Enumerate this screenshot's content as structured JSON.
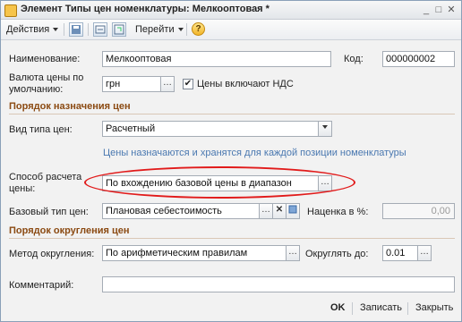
{
  "window": {
    "title": "Элемент Типы цен номенклатуры: Мелкооптовая *",
    "minimize": "_",
    "maximize": "□",
    "close": "✕"
  },
  "toolbar": {
    "actions_label": "Действия",
    "goto_label": "Перейти",
    "help_glyph": "?"
  },
  "form": {
    "name_label": "Наименование:",
    "name_value": "Мелкооптовая",
    "code_label": "Код:",
    "code_value": "000000002",
    "currency_label": "Валюта цены по умолчанию:",
    "currency_value": "грн",
    "vat_label": "Цены включают НДС",
    "vat_checked": true,
    "section_assign": "Порядок назначения цен",
    "price_type_kind_label": "Вид типа цен:",
    "price_type_kind_value": "Расчетный",
    "info_text": "Цены назначаются и хранятся для каждой позиции номенклатуры",
    "calc_method_label": "Способ расчета цены:",
    "calc_method_value": "По вхождению базовой цены в диапазон",
    "base_type_label": "Базовый тип цен:",
    "base_type_value": "Плановая себестоимость",
    "markup_label": "Наценка в %:",
    "markup_value": "0,00",
    "section_round": "Порядок округления цен",
    "round_method_label": "Метод округления:",
    "round_method_value": "По арифметическим правилам",
    "round_to_label": "Округлять до:",
    "round_to_value": "0.01",
    "comment_label": "Комментарий:",
    "comment_value": ""
  },
  "footer": {
    "ok_label": "OK",
    "save_label": "Записать",
    "close_label": "Закрыть"
  },
  "colors": {
    "section_title": "#8b4a12",
    "info_text": "#4a78b0",
    "highlight_ellipse": "#e11b1b"
  }
}
